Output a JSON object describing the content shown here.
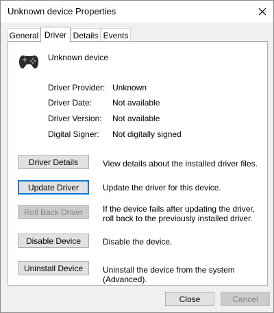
{
  "window": {
    "title": "Unknown device Properties"
  },
  "tabs": [
    {
      "label": "General"
    },
    {
      "label": "Driver"
    },
    {
      "label": "Details"
    },
    {
      "label": "Events"
    }
  ],
  "device": {
    "name": "Unknown device",
    "icon": "gamepad-icon"
  },
  "properties": [
    {
      "label": "Driver Provider:",
      "value": "Unknown"
    },
    {
      "label": "Driver Date:",
      "value": "Not available"
    },
    {
      "label": "Driver Version:",
      "value": "Not available"
    },
    {
      "label": "Digital Signer:",
      "value": "Not digitally signed"
    }
  ],
  "actions": [
    {
      "label": "Driver Details",
      "description": "View details about the installed driver files."
    },
    {
      "label": "Update Driver",
      "description": "Update the driver for this device."
    },
    {
      "label": "Roll Back Driver",
      "description": "If the device fails after updating the driver, roll back to the previously installed driver."
    },
    {
      "label": "Disable Device",
      "description": "Disable the device."
    },
    {
      "label": "Uninstall Device",
      "description": "Uninstall the device from the system (Advanced)."
    }
  ],
  "footer": {
    "close_label": "Close",
    "cancel_label": "Cancel"
  },
  "colors": {
    "focus": "#0078d7",
    "disabled_text": "#838383"
  }
}
